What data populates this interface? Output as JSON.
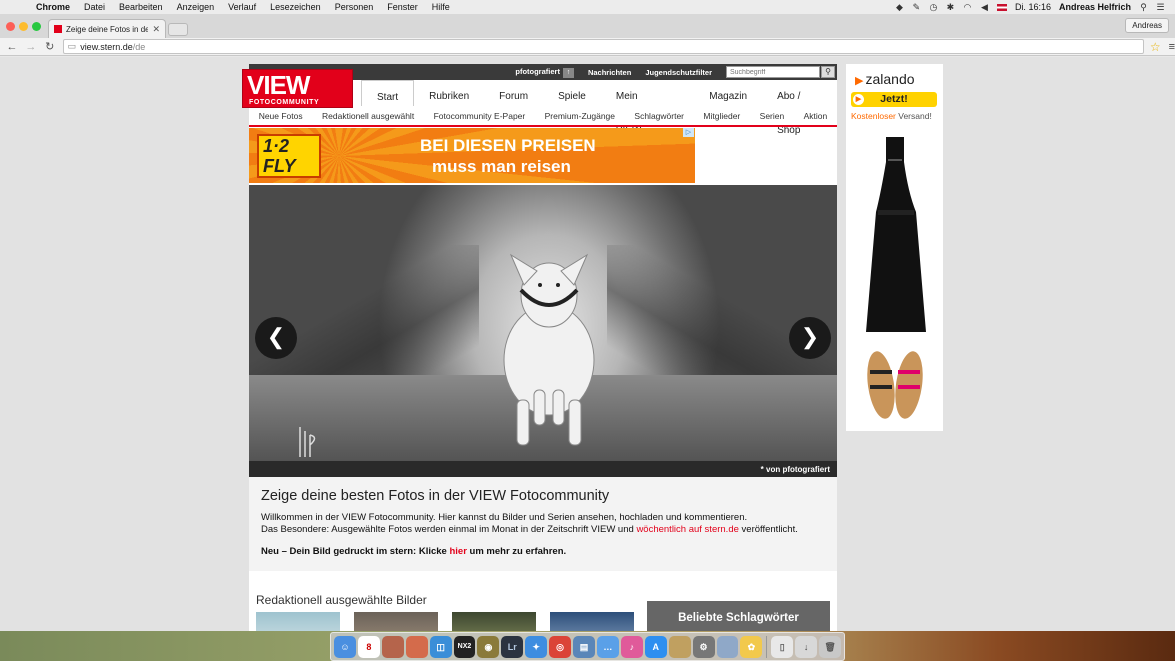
{
  "menubar": {
    "app": "Chrome",
    "items": [
      "Datei",
      "Bearbeiten",
      "Anzeigen",
      "Verlauf",
      "Lesezeichen",
      "Personen",
      "Fenster",
      "Hilfe"
    ],
    "clock": "Di. 16:16",
    "user": "Andreas Helfrich"
  },
  "browser": {
    "tab_title": "Zeige deine Fotos in der V",
    "profile": "Andreas",
    "url_host": "view.stern.de",
    "url_path": "/de"
  },
  "site": {
    "logo_main": "VIEW",
    "logo_sub": "FOTOCOMMUNITY",
    "toplinks": [
      "pfotografiert",
      "Nachrichten",
      "Jugendschutzfilter"
    ],
    "search_placeholder": "Suchbegriff",
    "mainnav": [
      "Start",
      "Rubriken",
      "Forum",
      "Spiele",
      "Mein VIEW",
      "Magazin",
      "Abo / Shop"
    ],
    "subnav": [
      "Neue Fotos",
      "Redaktionell ausgewählt",
      "Fotocommunity E-Paper",
      "Premium-Zugänge",
      "Schlagwörter",
      "Mitglieder",
      "Serien",
      "Aktion"
    ],
    "banner": {
      "brand": "1-2-FLY",
      "line1": "BEI DIESEN PREISEN",
      "line2": "muss man reisen"
    },
    "hero": {
      "prev": "❮",
      "next": "❯",
      "credit": "* von pfotografiert"
    },
    "intro": {
      "title": "Zeige deine besten Fotos in der VIEW Fotocommunity",
      "p1": "Willkommen in der VIEW Fotocommunity. Hier kannst du Bilder und Serien ansehen, hochladen und kommentieren.",
      "p2_start": "Das Besondere: Ausgewählte Fotos werden einmal im Monat in der Zeitschrift VIEW und ",
      "p2_link": "wöchentlich auf stern.de",
      "p2_end": " veröffentlicht.",
      "cta_start": "Neu – Dein Bild gedruckt im stern: Klicke ",
      "cta_link": "hier",
      "cta_end": " um mehr zu erfahren."
    },
    "section_title": "Redaktionell ausgewählte Bilder",
    "tags_title": "Beliebte Schlagwörter"
  },
  "side_ad": {
    "brand": "zalando",
    "button": "Jetzt!",
    "ship_highlight": "Kostenloser",
    "ship_rest": " Versand!"
  },
  "colors": {
    "accent": "#e2001a",
    "zalando": "#ff6900"
  }
}
